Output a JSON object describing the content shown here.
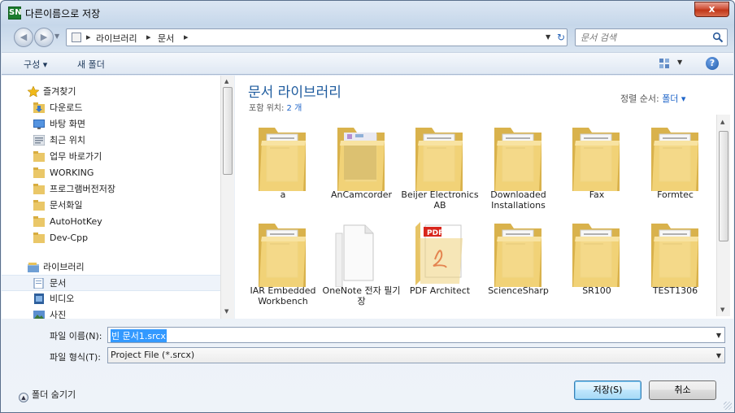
{
  "window": {
    "title": "다른이름으로 저장",
    "app_icon_text": "SN",
    "close_glyph": "x"
  },
  "address_bar": {
    "breadcrumbs": [
      "라이브러리",
      "문서"
    ],
    "search_placeholder": "문서 검색"
  },
  "toolbar": {
    "organize_label": "구성 ▾",
    "new_folder_label": "새 폴더"
  },
  "nav": {
    "items": [
      {
        "label": "즐겨찾기",
        "icon": "star-icon"
      },
      {
        "label": "다운로드",
        "icon": "downloads-folder-icon"
      },
      {
        "label": "바탕 화면",
        "icon": "desktop-icon"
      },
      {
        "label": "최근 위치",
        "icon": "recent-places-icon"
      },
      {
        "label": "업무 바로가기",
        "icon": "folder-icon"
      },
      {
        "label": "WORKING",
        "icon": "folder-icon"
      },
      {
        "label": "프로그램버전저장",
        "icon": "folder-icon"
      },
      {
        "label": "문서화일",
        "icon": "folder-icon"
      },
      {
        "label": "AutoHotKey",
        "icon": "folder-icon"
      },
      {
        "label": "Dev-Cpp",
        "icon": "folder-icon"
      },
      {
        "label": "라이브러리",
        "icon": "library-icon"
      },
      {
        "label": "문서",
        "icon": "documents-icon"
      },
      {
        "label": "비디오",
        "icon": "video-icon"
      },
      {
        "label": "사진",
        "icon": "pictures-icon"
      }
    ]
  },
  "library": {
    "title": "문서 라이브러리",
    "includes_label": "포함 위치:",
    "includes_count": "2 개",
    "sort_label": "정렬 순서:",
    "sort_value": "폴더 ▾"
  },
  "files": [
    {
      "name": "a",
      "type": "folder"
    },
    {
      "name": "AnCamcorder",
      "type": "folder-preview"
    },
    {
      "name": "Beijer Electronics AB",
      "type": "folder"
    },
    {
      "name": "Downloaded Installations",
      "type": "folder"
    },
    {
      "name": "Fax",
      "type": "folder"
    },
    {
      "name": "Formtec",
      "type": "folder"
    },
    {
      "name": "IAR Embedded Workbench",
      "type": "folder"
    },
    {
      "name": "OneNote 전자 필기장",
      "type": "folder-white"
    },
    {
      "name": "PDF Architect",
      "type": "pdf-folder"
    },
    {
      "name": "ScienceSharp",
      "type": "folder"
    },
    {
      "name": "SR100",
      "type": "folder"
    },
    {
      "name": "TEST1306",
      "type": "folder"
    }
  ],
  "form": {
    "filename_label": "파일 이름(N):",
    "filename_value": "빈 문서1.srcx",
    "filetype_label": "파일 형식(T):",
    "filetype_value": "Project File (*.srcx)"
  },
  "footer": {
    "hide_folders_label": "폴더 숨기기",
    "save_label": "저장(S)",
    "cancel_label": "취소"
  },
  "colors": {
    "accent": "#1e5b9e",
    "link": "#1e64c8",
    "selection": "#3399ff",
    "folder": "#f2d27a"
  }
}
